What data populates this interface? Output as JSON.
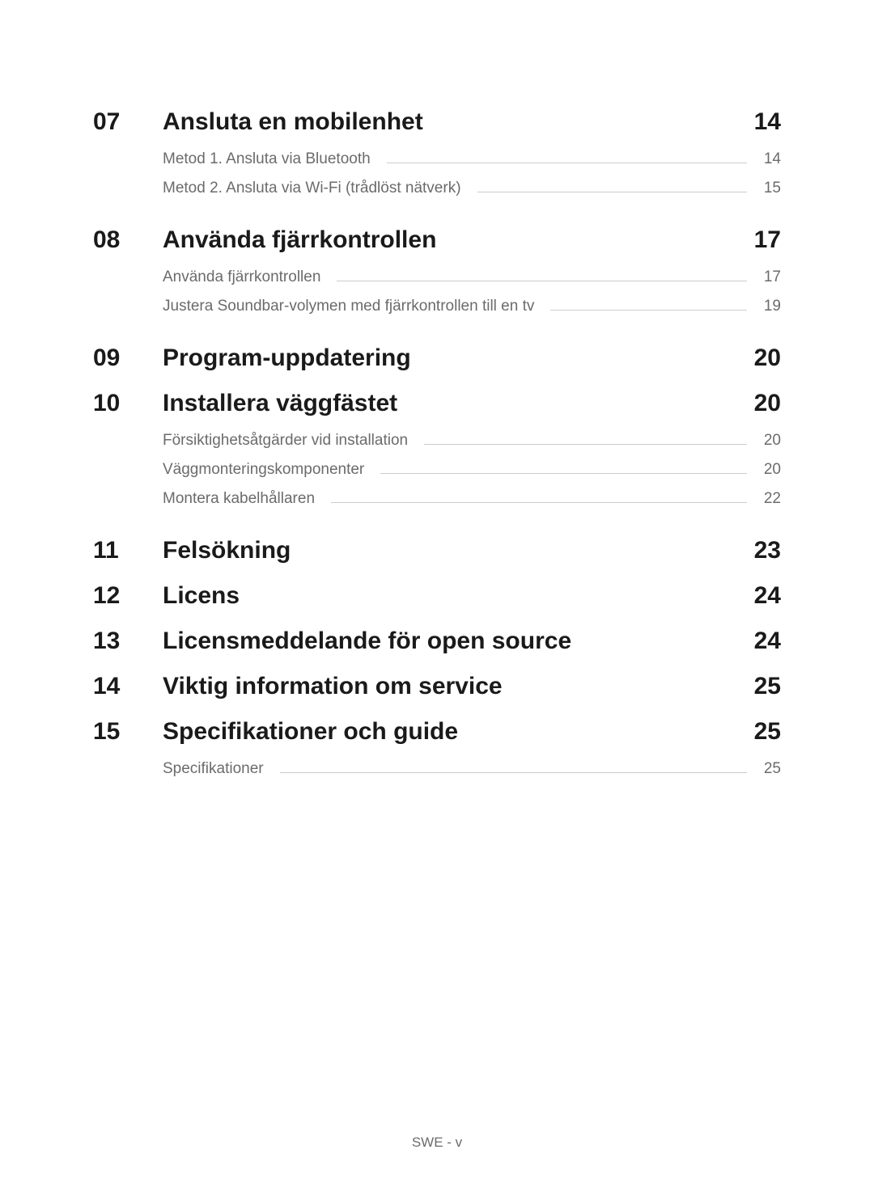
{
  "toc": [
    {
      "number": "07",
      "title": "Ansluta en mobilenhet",
      "page": "14",
      "items": [
        {
          "title": "Metod 1. Ansluta via Bluetooth",
          "page": "14"
        },
        {
          "title": "Metod 2. Ansluta via Wi-Fi (trådlöst nätverk)",
          "page": "15"
        }
      ]
    },
    {
      "number": "08",
      "title": "Använda fjärrkontrollen",
      "page": "17",
      "items": [
        {
          "title": "Använda fjärrkontrollen",
          "page": "17"
        },
        {
          "title": "Justera Soundbar-volymen med fjärrkontrollen till en tv",
          "page": "19"
        }
      ]
    },
    {
      "number": "09",
      "title": "Program-uppdatering",
      "page": "20",
      "items": []
    },
    {
      "number": "10",
      "title": "Installera väggfästet",
      "page": "20",
      "items": [
        {
          "title": "Försiktighetsåtgärder vid installation",
          "page": "20"
        },
        {
          "title": "Väggmonteringskomponenter",
          "page": "20"
        },
        {
          "title": "Montera kabelhållaren",
          "page": "22"
        }
      ]
    },
    {
      "number": "11",
      "title": "Felsökning",
      "page": "23",
      "items": []
    },
    {
      "number": "12",
      "title": "Licens",
      "page": "24",
      "items": []
    },
    {
      "number": "13",
      "title": "Licensmeddelande för open source",
      "page": "24",
      "items": []
    },
    {
      "number": "14",
      "title": "Viktig information om service",
      "page": "25",
      "items": []
    },
    {
      "number": "15",
      "title": "Specifikationer och guide",
      "page": "25",
      "items": [
        {
          "title": "Specifikationer",
          "page": "25"
        }
      ]
    }
  ],
  "footer": "SWE - v"
}
